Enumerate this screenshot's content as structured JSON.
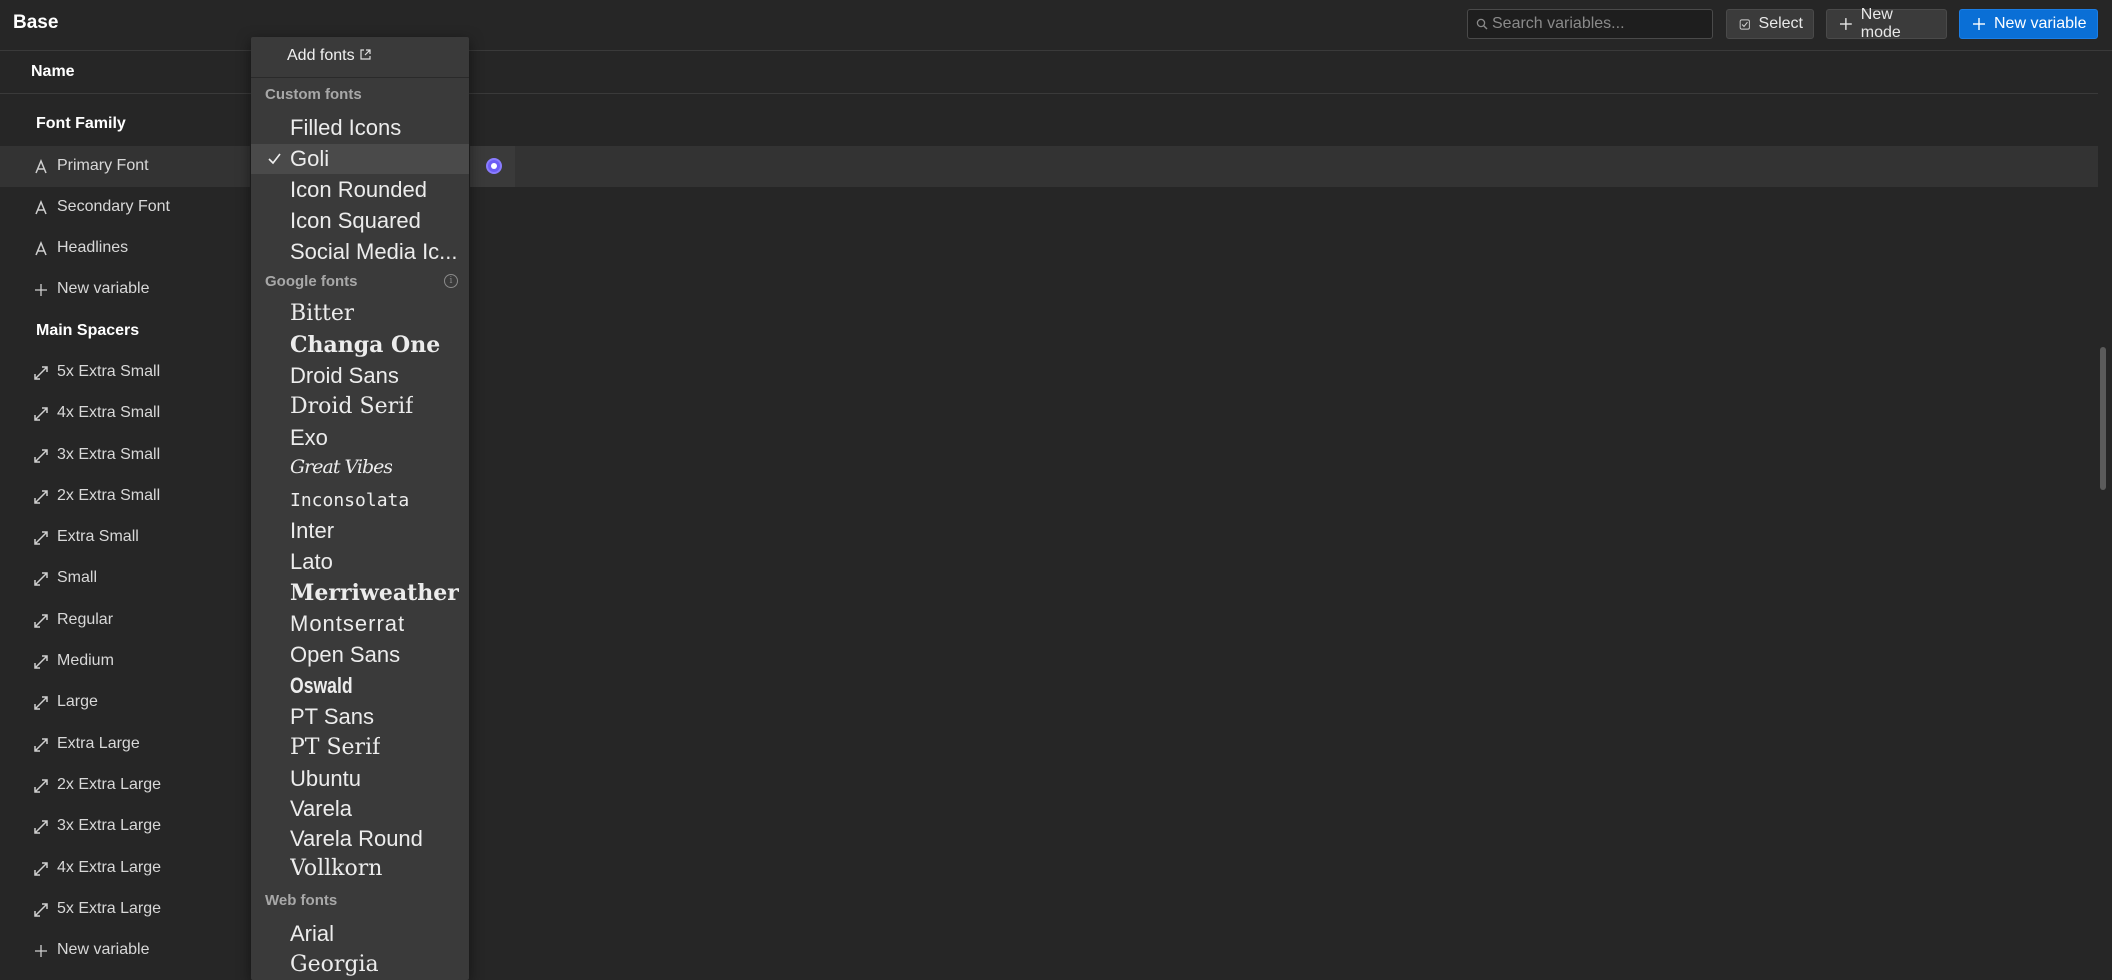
{
  "header": {
    "title": "Base",
    "search_placeholder": "Search variables...",
    "select_label": "Select",
    "new_mode_label": "New mode",
    "new_variable_label": "New variable",
    "accent": "#0a6fd6"
  },
  "table": {
    "name_header": "Name"
  },
  "groups": {
    "font_family": "Font Family",
    "main_spacers": "Main Spacers"
  },
  "font_vars": [
    "Primary Font",
    "Secondary Font",
    "Headlines"
  ],
  "new_variable": "New variable",
  "spacer_vars": [
    "5x Extra Small",
    "4x Extra Small",
    "3x Extra Small",
    "2x Extra Small",
    "Extra Small",
    "Small",
    "Regular",
    "Medium",
    "Large",
    "Extra Large",
    "2x Extra Large",
    "3x Extra Large",
    "4x Extra Large",
    "5x Extra Large"
  ],
  "dropdown": {
    "add_fonts": "Add fonts",
    "custom_title": "Custom fonts",
    "custom": [
      "Filled Icons",
      "Goli",
      "Icon Rounded",
      "Icon Squared",
      "Social Media Ic..."
    ],
    "selected": "Goli",
    "google_title": "Google fonts",
    "google": [
      "Bitter",
      "Changa One",
      "Droid Sans",
      "Droid Serif",
      "Exo",
      "Great Vibes",
      "Inconsolata",
      "Inter",
      "Lato",
      "Merriweather",
      "Montserrat",
      "Open Sans",
      "Oswald",
      "PT Sans",
      "PT Serif",
      "Ubuntu",
      "Varela",
      "Varela Round",
      "Vollkorn"
    ],
    "web_title": "Web fonts",
    "web": [
      "Arial",
      "Georgia"
    ]
  },
  "icons": {
    "font": "font-icon",
    "spacer": "resize-diagonal-icon",
    "plus": "plus-icon",
    "search": "search-icon",
    "check": "checkmark-icon",
    "external": "external-link-icon",
    "info": "info-icon"
  }
}
